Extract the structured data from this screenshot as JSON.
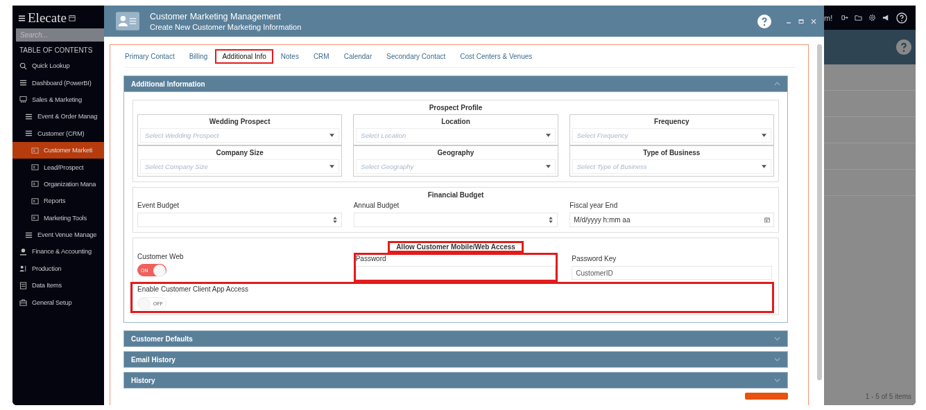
{
  "app": {
    "logo": "Elecate",
    "search": {
      "placeholder": "Search..."
    },
    "toc_heading": "TABLE OF CONTENTS",
    "top_bar_text": "m!",
    "footer": "1 - 5 of 5 items"
  },
  "sidebar": {
    "items": [
      {
        "label": "Quick Lookup",
        "selected": false
      },
      {
        "label": "Dashboard (PowerBI)",
        "selected": false
      },
      {
        "label": "Sales & Marketing",
        "selected": false,
        "children": [
          {
            "label": "Event & Order Manag",
            "selected": false
          },
          {
            "label": "Customer (CRM)",
            "selected": false,
            "children": [
              {
                "label": "Customer Marketi",
                "selected": true
              },
              {
                "label": "Lead/Prospect",
                "selected": false
              },
              {
                "label": "Organization Mana",
                "selected": false
              },
              {
                "label": "Reports",
                "selected": false
              },
              {
                "label": "Marketing Tools",
                "selected": false
              }
            ]
          },
          {
            "label": "Event Venue Manage",
            "selected": false
          }
        ]
      },
      {
        "label": "Finance & Accounting",
        "selected": false
      },
      {
        "label": "Production",
        "selected": false
      },
      {
        "label": "Data Items",
        "selected": false
      },
      {
        "label": "General Setup",
        "selected": false
      }
    ]
  },
  "dialog": {
    "title": "Customer Marketing Management",
    "subtitle": "Create New Customer Marketing Information",
    "tabs": [
      {
        "label": "Primary Contact",
        "selected": false,
        "highlighted": false
      },
      {
        "label": "Billing",
        "selected": false,
        "highlighted": false
      },
      {
        "label": "Additional Info",
        "selected": true,
        "highlighted": true
      },
      {
        "label": "Notes",
        "selected": false,
        "highlighted": false
      },
      {
        "label": "CRM",
        "selected": false,
        "highlighted": false
      },
      {
        "label": "Calendar",
        "selected": false,
        "highlighted": false
      },
      {
        "label": "Secondary Contact",
        "selected": false,
        "highlighted": false
      },
      {
        "label": "Cost Centers & Venues",
        "selected": false,
        "highlighted": false
      }
    ],
    "sections": [
      {
        "title": "Additional Information",
        "expanded": true
      },
      {
        "title": "Customer Defaults",
        "expanded": false
      },
      {
        "title": "Email History",
        "expanded": false
      },
      {
        "title": "History",
        "expanded": false
      }
    ],
    "prospect_profile": {
      "title": "Prospect Profile",
      "fields": [
        {
          "label": "Wedding Prospect",
          "placeholder": "Select Wedding Prospect"
        },
        {
          "label": "Location",
          "placeholder": "Select Location"
        },
        {
          "label": "Frequency",
          "placeholder": "Select Frequency"
        },
        {
          "label": "Company Size",
          "placeholder": "Select Company Size"
        },
        {
          "label": "Geography",
          "placeholder": "Select Geography"
        },
        {
          "label": "Type of Business",
          "placeholder": "Select Type of Business"
        }
      ]
    },
    "financial_budget": {
      "title": "Financial Budget",
      "fields": [
        {
          "label": "Event Budget",
          "kind": "number"
        },
        {
          "label": "Annual Budget",
          "kind": "number"
        },
        {
          "label": "Fiscal year End",
          "kind": "date",
          "value": "M/d/yyyy h:mm aa"
        }
      ]
    },
    "access": {
      "title": "Allow Customer Mobile/Web Access",
      "highlighted": true,
      "customer_web": {
        "label": "Customer Web",
        "on": true,
        "text": "ON"
      },
      "password": {
        "label": "Password",
        "highlighted": true
      },
      "password_key": {
        "label": "Password Key",
        "value": "CustomerID"
      },
      "client_app": {
        "label": "Enable Customer Client App Access",
        "on": false,
        "text": "OFF",
        "highlighted": true
      }
    }
  }
}
